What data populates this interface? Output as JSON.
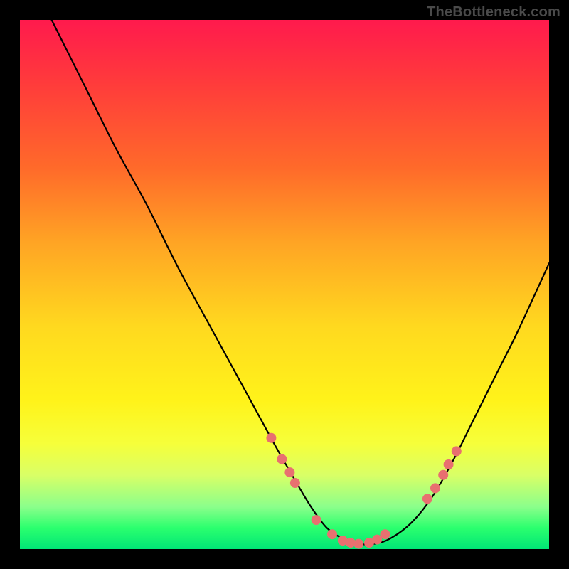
{
  "watermark": "TheBottleneck.com",
  "chart_data": {
    "type": "line",
    "title": "",
    "xlabel": "",
    "ylabel": "",
    "xlim": [
      0,
      100
    ],
    "ylim": [
      0,
      100
    ],
    "grid": false,
    "legend": false,
    "series": [
      {
        "name": "bottleneck-curve",
        "x": [
          6,
          12,
          18,
          24,
          30,
          36,
          42,
          48,
          52,
          55,
          58,
          61,
          64,
          67,
          70,
          74,
          78,
          82,
          86,
          90,
          94,
          100
        ],
        "y": [
          100,
          88,
          76,
          65,
          53,
          42,
          31,
          20,
          13,
          8,
          4,
          2,
          1,
          1,
          2,
          5,
          10,
          17,
          25,
          33,
          41,
          54
        ]
      }
    ],
    "markers": {
      "name": "highlight-dots",
      "color": "#e87070",
      "x": [
        47.5,
        49.5,
        51,
        52,
        56,
        59,
        61,
        62.5,
        64,
        66,
        67.5,
        69,
        77,
        78.5,
        80,
        81,
        82.5
      ],
      "y": [
        21,
        17,
        14.5,
        12.5,
        5.5,
        2.8,
        1.6,
        1.2,
        1.0,
        1.2,
        1.8,
        2.8,
        9.5,
        11.5,
        14,
        16,
        18.5
      ]
    }
  }
}
